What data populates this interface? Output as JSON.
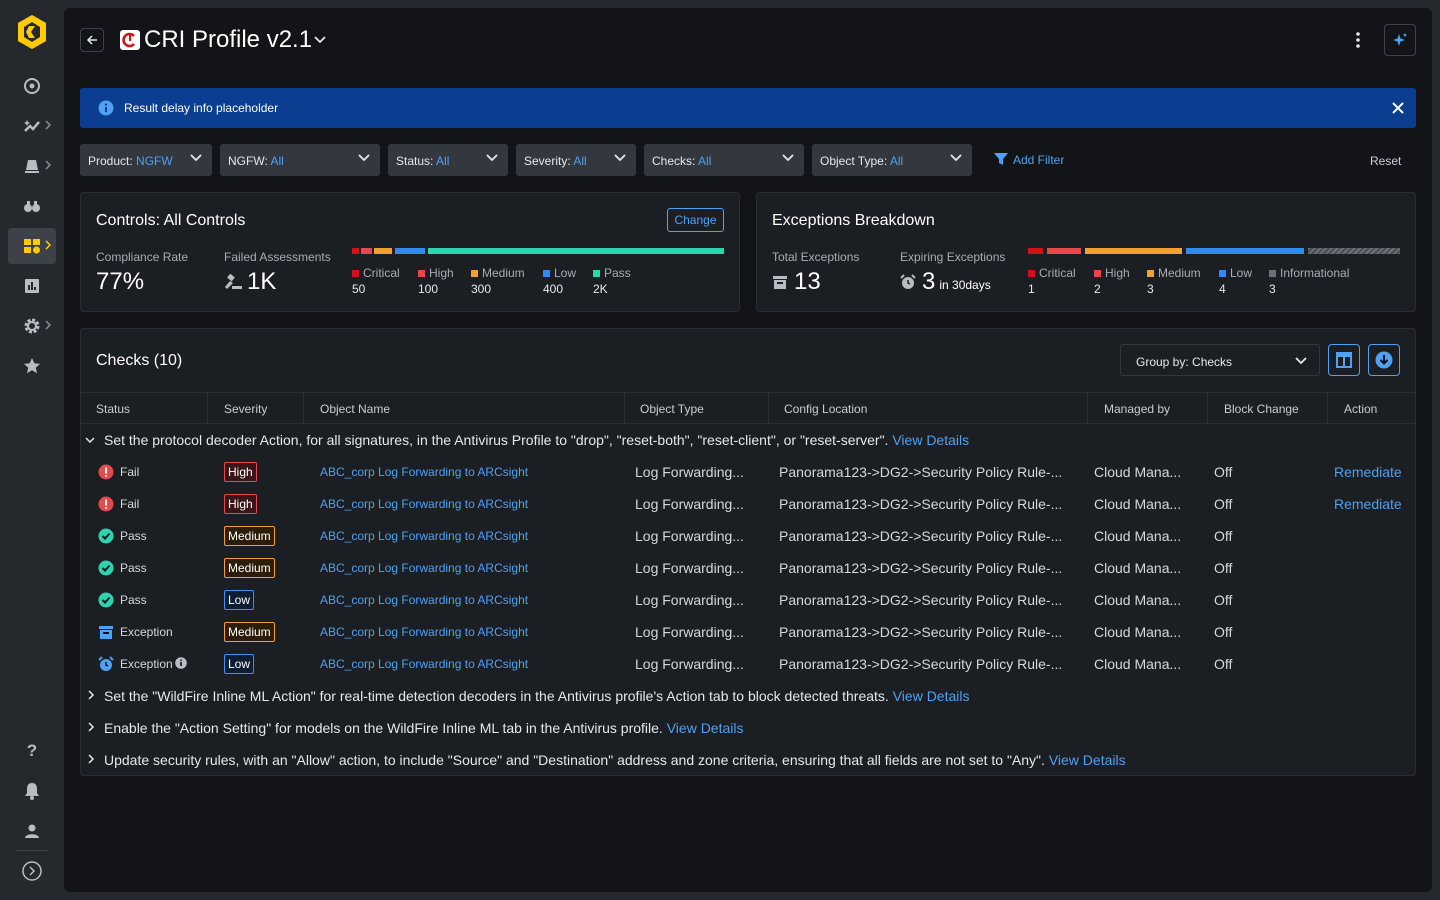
{
  "sidebar": {
    "items": [
      {
        "icon": "radar-icon"
      },
      {
        "icon": "analytics-icon"
      },
      {
        "icon": "alerts-icon"
      },
      {
        "icon": "binoculars-icon"
      },
      {
        "icon": "posture-icon"
      },
      {
        "icon": "reports-icon"
      },
      {
        "icon": "settings-icon"
      },
      {
        "icon": "favorites-icon"
      }
    ],
    "bottom": [
      {
        "icon": "help-icon",
        "glyph": "?"
      },
      {
        "icon": "bell-icon"
      },
      {
        "icon": "user-icon"
      },
      {
        "icon": "expand-icon"
      }
    ]
  },
  "header": {
    "title": "CRI Profile v2.1"
  },
  "banner": {
    "text": "Result delay info placeholder"
  },
  "filters": [
    {
      "label": "Product:",
      "value": "NGFW"
    },
    {
      "label": "NGFW:",
      "value": "All"
    },
    {
      "label": "Status:",
      "value": "All"
    },
    {
      "label": "Severity:",
      "value": "All"
    },
    {
      "label": "Checks:",
      "value": "All"
    },
    {
      "label": "Object Type:",
      "value": "All"
    }
  ],
  "add_filter": "Add Filter",
  "reset": "Reset",
  "controls": {
    "title": "Controls: All Controls",
    "change": "Change",
    "compliance_label": "Compliance Rate",
    "compliance_value": "77%",
    "failed_label": "Failed Assessments",
    "failed_value": "1K",
    "legend": [
      {
        "label": "Critical",
        "value": "50"
      },
      {
        "label": "High",
        "value": "100"
      },
      {
        "label": "Medium",
        "value": "300"
      },
      {
        "label": "Low",
        "value": "400"
      },
      {
        "label": "Pass",
        "value": "2K"
      }
    ]
  },
  "exceptions": {
    "title": "Exceptions Breakdown",
    "total_label": "Total Exceptions",
    "total_value": "13",
    "expiring_label": "Expiring Exceptions",
    "expiring_value": "3",
    "expiring_suffix": "in 30days",
    "legend": [
      {
        "label": "Critical",
        "value": "1"
      },
      {
        "label": "High",
        "value": "2"
      },
      {
        "label": "Medium",
        "value": "3"
      },
      {
        "label": "Low",
        "value": "4"
      },
      {
        "label": "Informational",
        "value": "3"
      }
    ]
  },
  "colors": {
    "critical": "#d0121b",
    "high": "#e5484d",
    "medium": "#f59e33",
    "low": "#2f8bee",
    "pass": "#2dd4b0",
    "info": "#6b7078",
    "accent": "#4ea1f3"
  },
  "checks": {
    "title": "Checks (10)",
    "group_by": "Group by: Checks",
    "columns": [
      "Status",
      "Severity",
      "Object Name",
      "Object Type",
      "Config Location",
      "Managed by",
      "Block Change",
      "Action"
    ],
    "groups": [
      {
        "text": "Set the protocol decoder Action, for all signatures, in the Antivirus Profile to \"drop\", \"reset-both\", \"reset-client\", or \"reset-server\".",
        "link": "View Details"
      },
      {
        "text": "Set the \"WildFire Inline ML Action\" for real-time detection decoders in the Antivirus profile's Action tab to block detected threats.",
        "link": "View Details"
      },
      {
        "text": "Enable the \"Action Setting\" for models on the WildFire Inline ML tab in the Antivirus profile.",
        "link": "View Details"
      },
      {
        "text": "Update security rules, with an \"Allow\" action, to include \"Source\" and \"Destination\" address and zone criteria, ensuring that all fields are not set to \"Any\".",
        "link": "View Details"
      }
    ],
    "rows": [
      {
        "status": "Fail",
        "status_icon": "fail-icon",
        "severity": "High",
        "object": "ABC_corp Log Forwarding to ARCsight",
        "type": "Log Forwarding...",
        "config": "Panorama123->DG2->Security Policy Rule-...",
        "managed": "Cloud Mana...",
        "block": "Off",
        "action": "Remediate"
      },
      {
        "status": "Fail",
        "status_icon": "fail-icon",
        "severity": "High",
        "object": "ABC_corp Log Forwarding to ARCsight",
        "type": "Log Forwarding...",
        "config": "Panorama123->DG2->Security Policy Rule-...",
        "managed": "Cloud Mana...",
        "block": "Off",
        "action": "Remediate"
      },
      {
        "status": "Pass",
        "status_icon": "pass-icon",
        "severity": "Medium",
        "object": "ABC_corp Log Forwarding to ARCsight",
        "type": "Log Forwarding...",
        "config": "Panorama123->DG2->Security Policy Rule-...",
        "managed": "Cloud Mana...",
        "block": "Off",
        "action": ""
      },
      {
        "status": "Pass",
        "status_icon": "pass-icon",
        "severity": "Medium",
        "object": "ABC_corp Log Forwarding to ARCsight",
        "type": "Log Forwarding...",
        "config": "Panorama123->DG2->Security Policy Rule-...",
        "managed": "Cloud Mana...",
        "block": "Off",
        "action": ""
      },
      {
        "status": "Pass",
        "status_icon": "pass-icon",
        "severity": "Low",
        "object": "ABC_corp Log Forwarding to ARCsight",
        "type": "Log Forwarding...",
        "config": "Panorama123->DG2->Security Policy Rule-...",
        "managed": "Cloud Mana...",
        "block": "Off",
        "action": ""
      },
      {
        "status": "Exception",
        "status_icon": "exception-icon",
        "severity": "Medium",
        "object": "ABC_corp Log Forwarding to ARCsight",
        "type": "Log Forwarding...",
        "config": "Panorama123->DG2->Security Policy Rule-...",
        "managed": "Cloud Mana...",
        "block": "Off",
        "action": ""
      },
      {
        "status": "Exception",
        "status_icon": "expiring-exception-icon",
        "severity": "Low",
        "object": "ABC_corp Log Forwarding to ARCsight",
        "type": "Log Forwarding...",
        "config": "Panorama123->DG2->Security Policy Rule-...",
        "managed": "Cloud Mana...",
        "block": "Off",
        "action": ""
      }
    ]
  }
}
